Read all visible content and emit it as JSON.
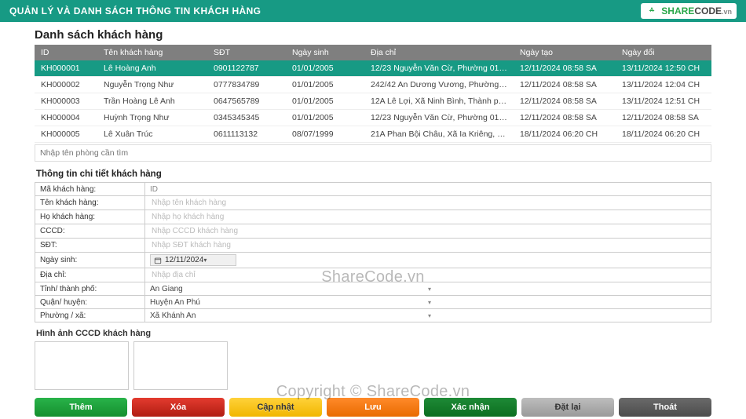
{
  "header": {
    "title": "QUẢN LÝ VÀ DANH SÁCH THÔNG TIN KHÁCH HÀNG",
    "logo_text1": "SHARE",
    "logo_text2": "CODE",
    "logo_ext": ".vn"
  },
  "page_title": "Danh sách khách hàng",
  "columns": [
    "ID",
    "Tên khách hàng",
    "SĐT",
    "Ngày sinh",
    "Địa chỉ",
    "Ngày tạo",
    "Ngày đổi"
  ],
  "col_widths": [
    "80",
    "140",
    "100",
    "100",
    "190",
    "130",
    "122"
  ],
  "rows": [
    {
      "id": "KH000001",
      "name": "Lê Hoàng Anh",
      "phone": "0901122787",
      "dob": "01/01/2005",
      "addr": "12/23 Nguyễn Văn Cừ, Phường 01, ...",
      "created": "12/11/2024 08:58 SA",
      "updated": "13/11/2024 12:50 CH",
      "selected": true
    },
    {
      "id": "KH000002",
      "name": "Nguyễn Trọng Như",
      "phone": "0777834789",
      "dob": "01/01/2005",
      "addr": "242/42 An Dương Vương, Phường 1...",
      "created": "12/11/2024 08:58 SA",
      "updated": "13/11/2024 12:04 CH",
      "selected": false
    },
    {
      "id": "KH000003",
      "name": "Trần Hoàng Lê Anh",
      "phone": "0647565789",
      "dob": "01/01/2005",
      "addr": "12A Lê Lợi, Xã Ninh Bình, Thành phố...",
      "created": "12/11/2024 08:58 SA",
      "updated": "13/11/2024 12:51 CH",
      "selected": false
    },
    {
      "id": "KH000004",
      "name": "Huỳnh Trọng Như",
      "phone": "0345345345",
      "dob": "01/01/2005",
      "addr": "12/23 Nguyễn Văn Cừ, Phường 01, ...",
      "created": "12/11/2024 08:58 SA",
      "updated": "12/11/2024 08:58 SA",
      "selected": false
    },
    {
      "id": "KH000005",
      "name": "Lê Xuân Trúc",
      "phone": "0611113132",
      "dob": "08/07/1999",
      "addr": "21A Phan Bội Châu, Xã Ia Kriêng, Hu...",
      "created": "18/11/2024 06:20 CH",
      "updated": "18/11/2024 06:20 CH",
      "selected": false
    }
  ],
  "search_room_placeholder": "Nhập tên phòng cần tìm",
  "detail_title": "Thông tin chi tiết khách hàng",
  "detail": {
    "id_label": "Mã khách hàng:",
    "id_value": "ID",
    "name_label": "Tên khách hàng:",
    "name_placeholder": "Nhập tên khách hàng",
    "surname_label": "Họ khách hàng:",
    "surname_placeholder": "Nhập họ khách hàng",
    "cccd_label": "CCCD:",
    "cccd_placeholder": "Nhập CCCD khách hàng",
    "phone_label": "SĐT:",
    "phone_placeholder": "Nhập SĐT khách hàng",
    "dob_label": "Ngày sinh:",
    "dob_value": "12/11/2024",
    "addr_label": "Địa chỉ:",
    "addr_placeholder": "Nhập địa chỉ",
    "province_label": "Tỉnh/ thành phố:",
    "province_value": "An Giang",
    "district_label": "Quận/ huyện:",
    "district_value": "Huyện An Phú",
    "ward_label": "Phường / xã:",
    "ward_value": "Xã Khánh An"
  },
  "cccd_image_title": "Hình ảnh CCCD khách hàng",
  "buttons": {
    "add": "Thêm",
    "delete": "Xóa",
    "update": "Cập nhật",
    "save": "Lưu",
    "confirm": "Xác nhận",
    "reset": "Đặt lại",
    "exit": "Thoát"
  },
  "watermark1": "ShareCode.vn",
  "watermark2": "Copyright © ShareCode.vn"
}
